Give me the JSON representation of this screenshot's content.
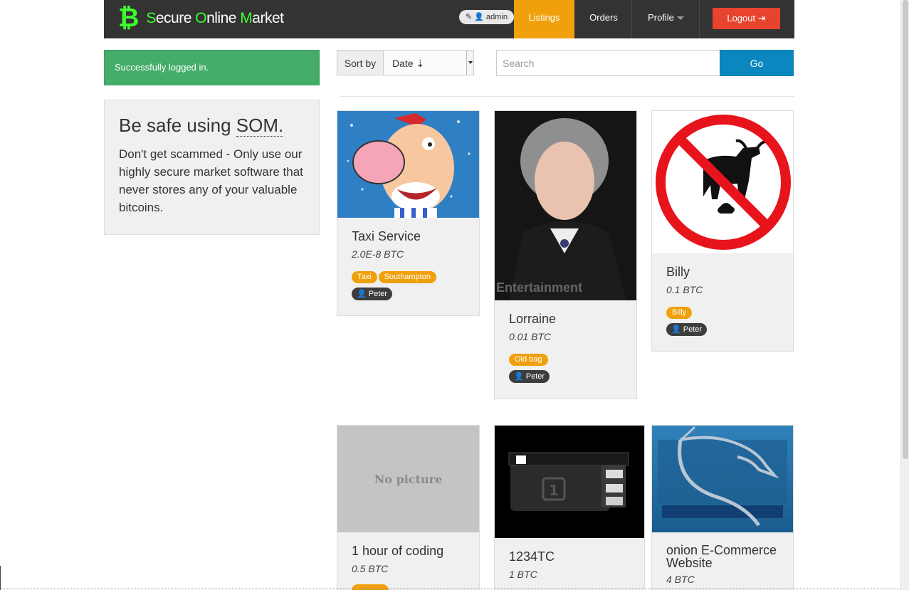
{
  "brand": {
    "s": "S",
    "ecure": "ecure ",
    "o": "O",
    "nline": "nline ",
    "m": "M",
    "arket": "arket",
    "color": "#3eff2e"
  },
  "navbar": {
    "admin_badge": "admin",
    "listings": "Listings",
    "orders": "Orders",
    "profile": "Profile",
    "logout": "Logout",
    "accent": "#f0a00b"
  },
  "alert": {
    "text": "Successfully logged in."
  },
  "promo": {
    "heading": "Be safe using",
    "heading_abbr": "SOM.",
    "text": "Don't get scammed - Only use our highly secure market software that never stores any of your valuable bitcoins."
  },
  "toolbar": {
    "sort_label": "Sort by",
    "sort_value": "Date ⇣",
    "search_placeholder": "Search",
    "go": "Go"
  },
  "listings": [
    {
      "title": "Taxi Service",
      "price": "2.0E-8 BTC",
      "tags": [
        "Taxi",
        "Southampton"
      ],
      "user": "Peter"
    },
    {
      "title": "Lorraine",
      "price": "0.01 BTC",
      "tags": [
        "Old bag"
      ],
      "user": "Peter",
      "image_caption": "Entertainment"
    },
    {
      "title": "Billy",
      "price": "0.1 BTC",
      "tags": [
        "Billy"
      ],
      "user": "Peter"
    },
    {
      "title": "1 hour of coding",
      "price": "0.5 BTC",
      "no_picture": "No picture"
    },
    {
      "title": "1234TC",
      "price": "1 BTC"
    },
    {
      "title": "onion E-Commerce Website",
      "price": "4 BTC"
    }
  ]
}
